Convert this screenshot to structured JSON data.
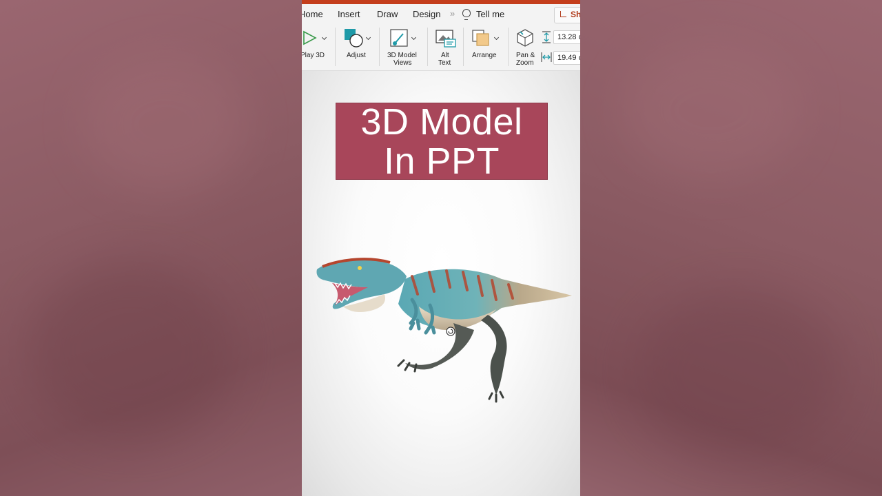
{
  "ribbon_tabs": {
    "home": "Home",
    "insert": "Insert",
    "draw": "Draw",
    "design": "Design",
    "more": "»",
    "tell_me": "Tell me",
    "share": "Sh"
  },
  "toolbar": {
    "play3d": "Play 3D",
    "adjust": "Adjust",
    "model_views_line1": "3D Model",
    "model_views_line2": "Views",
    "alt_text_line1": "Alt",
    "alt_text_line2": "Text",
    "arrange": "Arrange",
    "pan_zoom_line1": "Pan &",
    "pan_zoom_line2": "Zoom",
    "height_value": "13.28 c",
    "width_value": "19.49 c"
  },
  "slide": {
    "title_line1": "3D Model",
    "title_line2": "In PPT",
    "title_bg": "#a8465a"
  },
  "colors": {
    "accent": "#c43e1c",
    "background": "#8a5a62"
  },
  "icons": [
    "play-icon",
    "adjust-icon",
    "model-views-icon",
    "alt-text-icon",
    "arrange-icon",
    "pan-zoom-icon",
    "height-icon",
    "width-icon",
    "lightbulb-icon",
    "share-icon",
    "rotate-handle-icon"
  ]
}
